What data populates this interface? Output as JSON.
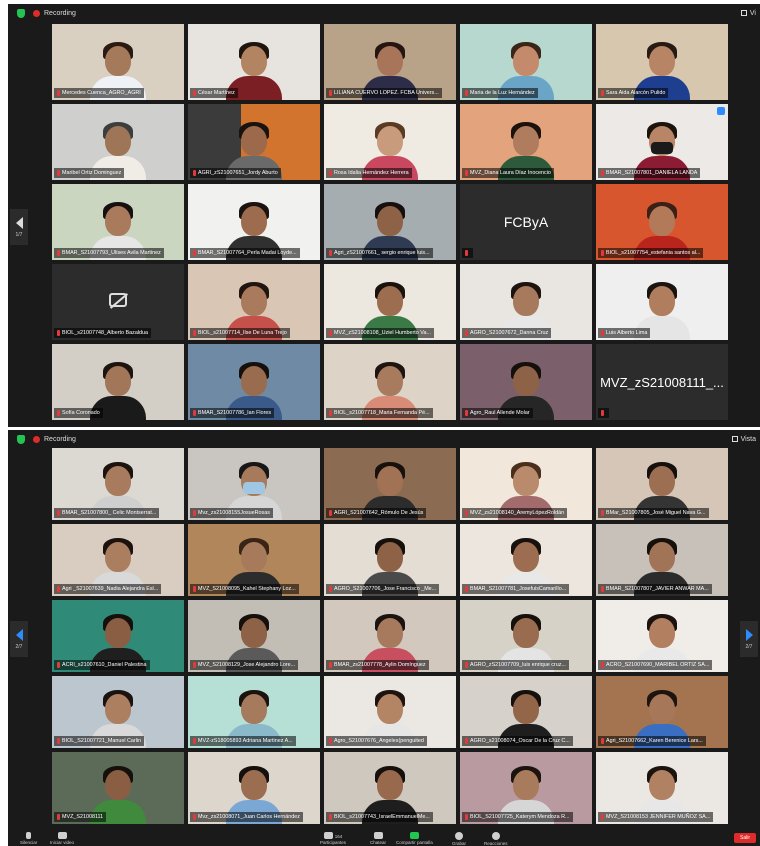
{
  "window1": {
    "recording_label": "Recording",
    "view_label": "Vi",
    "page_indicator": "1/7",
    "tiles": [
      {
        "name": "Mercedes Cuenca_AGRO_AGRI",
        "bg": "#d9d0c2",
        "skin": "#a57a5a",
        "hair": "#2a1a12",
        "shirt": "#eef1f6"
      },
      {
        "name": "César Martínez",
        "bg": "#e7e4df",
        "skin": "#b38462",
        "hair": "#1f150f",
        "shirt": "#7b1f24"
      },
      {
        "name": "LILIANA CUERVO LOPEZ. FCBA Univers...",
        "bg": "#b9a388",
        "skin": "#a8755b",
        "hair": "#241510",
        "shirt": "#2d2d4a"
      },
      {
        "name": "Maria de la Luz Hernández",
        "bg": "#b6d8cf",
        "skin": "#c38a6c",
        "hair": "#3a2518",
        "shirt": "#6aa5c8"
      },
      {
        "name": "Sara Aida Alarcón Pulido",
        "bg": "#d7c7ae",
        "skin": "#b78565",
        "hair": "#271913",
        "shirt": "#1e3f8f"
      },
      {
        "name": "Maribel Ortiz Dominguez",
        "bg": "#cfcfcd",
        "skin": "#9f7558",
        "hair": "#3d3d3d",
        "shirt": "#f0ede6"
      },
      {
        "name": "AGRI_zS21007651_Jordy Aburto",
        "bg": "#3b3b3b",
        "skin": "#9c6a4b",
        "hair": "#1a120c",
        "shirt": "#6a6a6a",
        "bg2": "#d2742d"
      },
      {
        "name": "Rosa Idalia Hernández Herrera",
        "bg": "#efeae2",
        "skin": "#c89b7c",
        "hair": "#5a3a22",
        "shirt": "#c9485f"
      },
      {
        "name": "MVZ_Diana Laura Díaz Inocencio",
        "bg": "#e3a37c",
        "skin": "#b07c5e",
        "hair": "#1b120d",
        "shirt": "#2d5a3a"
      },
      {
        "name": "BMAR_S21007801_DANIELA LANDA",
        "bg": "#ece9e6",
        "skin": "#b88567",
        "hair": "#1c130d",
        "shirt": "#8b1c34",
        "mask": true,
        "pin": true
      },
      {
        "name": "BMAR_S21007793_Ulises Avila Martinez",
        "bg": "#cbd6c0",
        "skin": "#a97a5c",
        "hair": "#161110",
        "shirt": "#e6e6e6"
      },
      {
        "name": "BMAR_S21007764_Perla Madai Loyde...",
        "bg": "#f1f1ef",
        "skin": "#9d6c4e",
        "hair": "#1b1311",
        "shirt": "#303030"
      },
      {
        "name": "Agri_zS21007661_ sergio enrique luis...",
        "bg": "#a6adb0",
        "skin": "#8e6246",
        "hair": "#15100d",
        "shirt": "#2e3b52"
      },
      {
        "name": "",
        "text": "FCByA",
        "bg": "#2c2c2c"
      },
      {
        "name": "BIOL_s21007754_estefania santos al...",
        "bg": "#d8562e",
        "skin": "#b37a5a",
        "hair": "#3a2016",
        "shirt": "#b9251d"
      },
      {
        "name": "BIOL_s21007748_Alberto Bazaldua",
        "camoff": true,
        "bg": "#2c2c2c"
      },
      {
        "name": "BIOL_s21007714_Ilse De Luna Trejo",
        "bg": "#d9c6b5",
        "skin": "#a97a5c",
        "hair": "#20150f",
        "shirt": "#c6504a"
      },
      {
        "name": "MVZ_zS21008108_Uziel Humberto Va...",
        "bg": "#ece8e0",
        "skin": "#9c6d4f",
        "hair": "#1a120d",
        "shirt": "#3b7a46"
      },
      {
        "name": "AGRO_S21007672_Danna Cruz",
        "bg": "#e9e6e1",
        "skin": "#a87a5d",
        "hair": "#1d140f",
        "shirt": "#e7e7e7"
      },
      {
        "name": "Luis Alberto Lima",
        "bg": "#efefef",
        "skin": "#b07d5e",
        "hair": "#1b1310",
        "shirt": "#e5e5e5"
      },
      {
        "name": "Sofía Coronado",
        "bg": "#d3cfc6",
        "skin": "#a27658",
        "hair": "#1d1410",
        "shirt": "#1a1a1a"
      },
      {
        "name": "BMAR_S21007786_Ian Flores",
        "bg": "#6f8aa5",
        "skin": "#9a6c4f",
        "hair": "#15100c",
        "shirt": "#3a5a8a"
      },
      {
        "name": "BIOL_s21007718_Maria Fernanda Pé...",
        "bg": "#ddd3c6",
        "skin": "#a97b5e",
        "hair": "#1e1410",
        "shirt": "#d88b76"
      },
      {
        "name": "Agro_Raul Allende Molar",
        "bg": "#7b5f6b",
        "skin": "#8e6246",
        "hair": "#15100c",
        "shirt": "#262626"
      },
      {
        "name": "",
        "text": "MVZ_zS21008111_...",
        "bg": "#2c2c2c",
        "active": true
      }
    ]
  },
  "window2": {
    "recording_label": "Recording",
    "view_label": "Vista",
    "page_indicator_left": "2/7",
    "page_indicator_right": "2/7",
    "tiles": [
      {
        "name": "BMAR_S21007800_ Celic Montserrat...",
        "bg": "#dcd8d2",
        "skin": "#a87b5e",
        "hair": "#1c130e",
        "shirt": "#cfcfcf"
      },
      {
        "name": "Mvz_zs21008155JosueRosas",
        "bg": "#c9c6c1",
        "skin": "#a77a5c",
        "hair": "#171717",
        "shirt": "#d6d6d6",
        "mask": true
      },
      {
        "name": "AGRI_S21007642_Rómulo De Jesús",
        "bg": "#8b6b52",
        "skin": "#a17254",
        "hair": "#17100c",
        "shirt": "#2c2c2c"
      },
      {
        "name": "MVZ_zs21008140_AremyLópezRoldán",
        "bg": "#f1e7da",
        "skin": "#b98a6b",
        "hair": "#4a2f1c",
        "shirt": "#a36b6b"
      },
      {
        "name": "BMar_S21007805_José Miguel Nava G...",
        "bg": "#d6c6b7",
        "skin": "#9d6f52",
        "hair": "#15100c",
        "shirt": "#343434"
      },
      {
        "name": "Agri _S21007639_Nadia Alejandra Esl...",
        "bg": "#d9cdc1",
        "skin": "#ab7e60",
        "hair": "#1c130f",
        "shirt": "#d9d9d9"
      },
      {
        "name": "MVZ_S21008095_Kahel Stephany Loz...",
        "bg": "#b1865a",
        "skin": "#a87a5c",
        "hair": "#3a2416",
        "shirt": "#2c2c2c"
      },
      {
        "name": "AGRO_S21007706_Jose Francisco _Me...",
        "bg": "#e3ddd4",
        "skin": "#8d6246",
        "hair": "#16100c",
        "shirt": "#4a4a4a"
      },
      {
        "name": "BMAR_S21007781_JosefuisCamarillo...",
        "bg": "#ece6de",
        "skin": "#9c6d50",
        "hair": "#17110d",
        "shirt": "#e8e8e8"
      },
      {
        "name": "BMAR_S21007807_JAVIER ANWAR MA...",
        "bg": "#c8c1ba",
        "skin": "#a27457",
        "hair": "#15100c",
        "shirt": "#2b2b2b"
      },
      {
        "name": "ACRI_s21007610_Daniel Palestina",
        "bg": "#2f8b77",
        "skin": "#8a5e43",
        "hair": "#15100c",
        "shirt": "#1f1f1f"
      },
      {
        "name": "MVZ_S21008129_Jose Alejandro Lore...",
        "bg": "#c2beb6",
        "skin": "#8e6246",
        "hair": "#15100c",
        "shirt": "#5a5a5a"
      },
      {
        "name": "BMAR_zs21007778_Aylin Domínguez",
        "bg": "#d3c8bd",
        "skin": "#a77a5d",
        "hair": "#1b130f",
        "shirt": "#c84f5f"
      },
      {
        "name": "AGRO_zS21007709_luis enrique cruz...",
        "bg": "#d7d2c8",
        "skin": "#9a6c4f",
        "hair": "#16100c",
        "shirt": "#e4e4e4"
      },
      {
        "name": "ACRO_S21007690_MARIBEL ORTIZ SA...",
        "bg": "#f0ede9",
        "skin": "#b27f60",
        "hair": "#1b120e",
        "shirt": "#e9e9e9"
      },
      {
        "name": "BIOL_S21007721_Manuel Carlin",
        "bg": "#bcc6cf",
        "skin": "#ad7f61",
        "hair": "#1a130f",
        "shirt": "#d9d9d9"
      },
      {
        "name": "MVZ-zS18005893 Adriana Martinez A...",
        "bg": "#b6e0d6",
        "skin": "#a67a5d",
        "hair": "#1c130e",
        "shirt": "#8ab9c9"
      },
      {
        "name": "Agro_S21007676_Angeles(penguited",
        "bg": "#ebe8e4",
        "skin": "#b38565",
        "hair": "#1d140f",
        "shirt": "#e6e6e6"
      },
      {
        "name": "AGRO_s21008074_Oscar De la Cruz C...",
        "bg": "#d6d1ca",
        "skin": "#93664a",
        "hair": "#15100c",
        "shirt": "#1e1e1e"
      },
      {
        "name": "Agri_S21007662_Karen Berenice Lars...",
        "bg": "#a3744f",
        "skin": "#a67859",
        "hair": "#1e140f",
        "shirt": "#3a6ec3"
      },
      {
        "name": "MVZ_S21008111",
        "bg": "#5c6b58",
        "skin": "#8a5e43",
        "hair": "#16100c",
        "shirt": "#3f8a3c"
      },
      {
        "name": "Mvz_zs21008071_Juan Carlos Hernández",
        "bg": "#dcd6cd",
        "skin": "#9c6e51",
        "hair": "#15100c",
        "shirt": "#7aa7d4"
      },
      {
        "name": "BIOL_s21007743_IsraelEmmanuelMe...",
        "bg": "#cfc8be",
        "skin": "#98694d",
        "hair": "#15100c",
        "shirt": "#1e1e1e"
      },
      {
        "name": "BIOL_S21007725_Katerym Mendoza R...",
        "bg": "#b89aa0",
        "skin": "#a97b5d",
        "hair": "#1c130f",
        "shirt": "#d6d6d6"
      },
      {
        "name": "MVZ_S21008153 JENNIFER MUÑOZ SA...",
        "bg": "#ebe8e3",
        "skin": "#b08162",
        "hair": "#1c130f",
        "shirt": "#e7e7e7"
      }
    ]
  },
  "toolbar": {
    "mute_label": "Silenciar",
    "video_label": "Iniciar video",
    "participants_label": "Participantes",
    "participants_count": "164",
    "chat_label": "Chatear",
    "share_label": "Compartir pantalla",
    "record_label": "Grabar",
    "reactions_label": "Reacciones",
    "leave_label": "Salir"
  }
}
